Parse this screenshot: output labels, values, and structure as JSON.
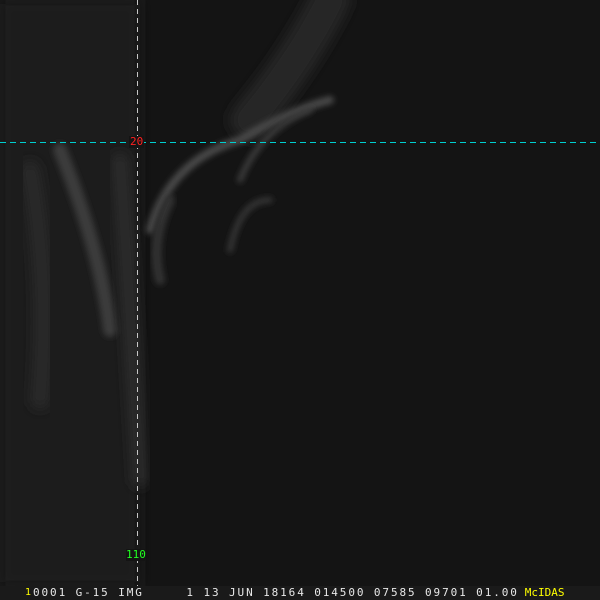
{
  "colors": {
    "lat_line": "#00d0d0",
    "lon_line": "#c8c8c8",
    "lat_label": "#ff2020",
    "lon_label": "#20ff20",
    "frame_num": "#ffff00",
    "logo": "#ffff00"
  },
  "grid": {
    "lat_label": "20",
    "lon_label": "110"
  },
  "status": {
    "frame_number": "1",
    "info": "0001 G-15 IMG     1 13 JUN 18164 014500 07585 09701 01.00",
    "logo": "McIDAS"
  }
}
